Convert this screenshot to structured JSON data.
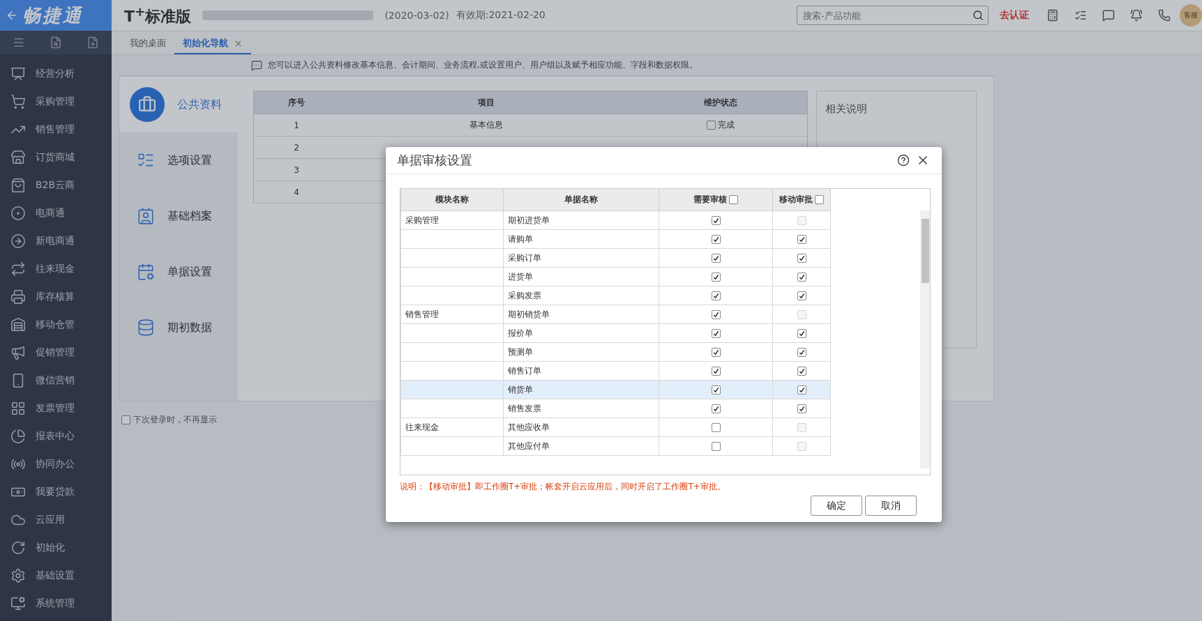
{
  "logo": {
    "text": "畅捷通"
  },
  "header": {
    "product": "T$^{+}$标准版",
    "date": "(2020-03-02)",
    "expiry": "有效期:2021-02-20",
    "search": {
      "placeholder": "搜索-产品功能"
    },
    "certify": "去认证",
    "service_badge": "客服"
  },
  "sidebar": {
    "items": [
      {
        "label": "经营分析"
      },
      {
        "label": "采购管理"
      },
      {
        "label": "销售管理"
      },
      {
        "label": "订货商城"
      },
      {
        "label": "B2B云商"
      },
      {
        "label": "电商通"
      },
      {
        "label": "新电商通"
      },
      {
        "label": "往来现金"
      },
      {
        "label": "库存核算"
      },
      {
        "label": "移动仓管"
      },
      {
        "label": "促销管理"
      },
      {
        "label": "微信营销"
      },
      {
        "label": "发票管理"
      },
      {
        "label": "报表中心"
      },
      {
        "label": "协同办公"
      },
      {
        "label": "我要贷款"
      },
      {
        "label": "云应用"
      },
      {
        "label": "初始化"
      },
      {
        "label": "基础设置"
      },
      {
        "label": "系统管理"
      }
    ]
  },
  "tabs": [
    {
      "label": "我的桌面",
      "selected": false,
      "closable": false
    },
    {
      "label": "初始化导航",
      "selected": true,
      "closable": true
    }
  ],
  "info": "您可以进入公共资料修改基本信息、会计期间、业务流程,或设置用户、用户组以及赋予相应功能、字段和数据权限。",
  "nav": [
    {
      "label": "公共资料",
      "selected": true
    },
    {
      "label": "选项设置",
      "selected": false
    },
    {
      "label": "基础档案",
      "selected": false
    },
    {
      "label": "单据设置",
      "selected": false
    },
    {
      "label": "期初数据",
      "selected": false
    }
  ],
  "table": {
    "columns": [
      "序号",
      "项目",
      "维护状态"
    ],
    "rows": [
      {
        "index": "1",
        "item": "基本信息",
        "status": "完成",
        "checked": false
      },
      {
        "index": "2"
      },
      {
        "index": "3"
      },
      {
        "index": "4"
      }
    ]
  },
  "related": {
    "title": "相关说明"
  },
  "dont_show": {
    "label": "下次登录时，不再显示",
    "checked": false
  },
  "dialog": {
    "title": "单据审核设置",
    "columns": [
      {
        "label": "模块名称"
      },
      {
        "label": "单据名称"
      },
      {
        "label": "需要审核",
        "checked": false
      },
      {
        "label": "移动审批",
        "checked": false
      }
    ],
    "rows": [
      {
        "module": "采购管理",
        "doc": "期初进货单",
        "audit": {
          "checked": true,
          "disabled": false
        },
        "mobile": {
          "checked": false,
          "disabled": true
        },
        "selected": false
      },
      {
        "doc": "请购单",
        "audit": {
          "checked": true,
          "disabled": false
        },
        "mobile": {
          "checked": true,
          "disabled": false
        },
        "selected": false
      },
      {
        "doc": "采购订单",
        "audit": {
          "checked": true,
          "disabled": false
        },
        "mobile": {
          "checked": true,
          "disabled": false
        },
        "selected": false
      },
      {
        "doc": "进货单",
        "audit": {
          "checked": true,
          "disabled": false
        },
        "mobile": {
          "checked": true,
          "disabled": false
        },
        "selected": false
      },
      {
        "doc": "采购发票",
        "audit": {
          "checked": true,
          "disabled": false
        },
        "mobile": {
          "checked": true,
          "disabled": false
        },
        "selected": false
      },
      {
        "module": "销售管理",
        "doc": "期初销货单",
        "audit": {
          "checked": true,
          "disabled": false
        },
        "mobile": {
          "checked": false,
          "disabled": true
        },
        "selected": false
      },
      {
        "doc": "报价单",
        "audit": {
          "checked": true,
          "disabled": false
        },
        "mobile": {
          "checked": true,
          "disabled": false
        },
        "selected": false
      },
      {
        "doc": "预测单",
        "audit": {
          "checked": true,
          "disabled": false
        },
        "mobile": {
          "checked": true,
          "disabled": false
        },
        "selected": false
      },
      {
        "doc": "销售订单",
        "audit": {
          "checked": true,
          "disabled": false
        },
        "mobile": {
          "checked": true,
          "disabled": false
        },
        "selected": false
      },
      {
        "doc": "销货单",
        "audit": {
          "checked": true,
          "disabled": false
        },
        "mobile": {
          "checked": true,
          "disabled": false
        },
        "selected": true
      },
      {
        "doc": "销售发票",
        "audit": {
          "checked": true,
          "disabled": false
        },
        "mobile": {
          "checked": true,
          "disabled": false
        },
        "selected": false
      },
      {
        "module": "往来现金",
        "doc": "其他应收单",
        "audit": {
          "checked": false,
          "disabled": false
        },
        "mobile": {
          "checked": false,
          "disabled": true
        },
        "selected": false
      },
      {
        "doc": "其他应付单",
        "audit": {
          "checked": false,
          "disabled": false
        },
        "mobile": {
          "checked": false,
          "disabled": true
        },
        "selected": false
      }
    ],
    "note": "说明：【移动审批】即工作圈T+审批；帐套开启云应用后，同时开启了工作圈T+审批。",
    "buttons": [
      "确定",
      "取消"
    ]
  }
}
